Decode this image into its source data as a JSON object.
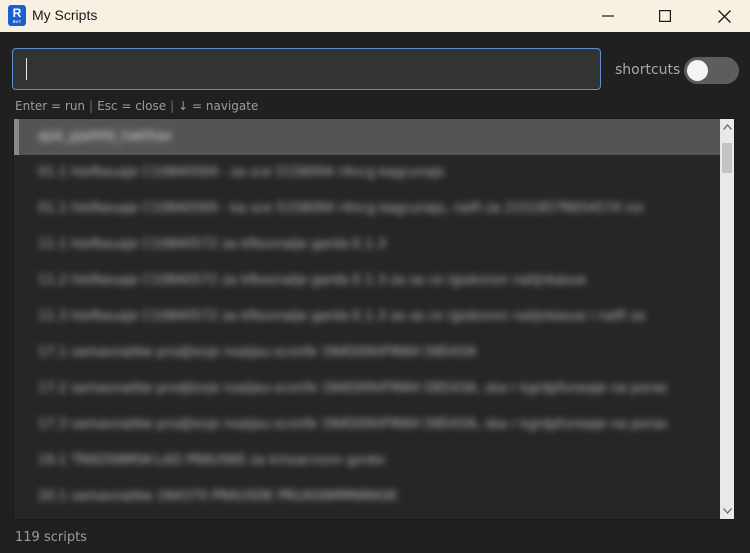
{
  "window": {
    "app_icon_letter": "R",
    "app_icon_sub": "RVT",
    "title": "My Scripts",
    "minimize_icon": "minimize-icon",
    "maximize_icon": "maximize-icon",
    "close_icon": "close-icon"
  },
  "search": {
    "value": "",
    "placeholder": ""
  },
  "shortcuts": {
    "label": "shortcuts",
    "enabled": false
  },
  "hints": {
    "run": "Enter = run",
    "close": "Esc = close",
    "navigate": "↓ = navigate",
    "separator": "|"
  },
  "scripts": {
    "items": [
      {
        "label": "ajsk_pjalhfd_haklhas"
      },
      {
        "label": "01.1 hlofkeuaje C10840569 - za sce 5158094 r4ncg kagcunajs"
      },
      {
        "label": "01.1 hlofkeuaje C10840569 - ka sce 5158094 r4ncg kagcunajs, nalfi za 2151857R654574 nsi"
      },
      {
        "label": "11.1 hlofkeuaje C10840572 za kfkovnalje garda E.1.3"
      },
      {
        "label": "11.2 hlofkeuaje C10840572 za kfkovnalje garda E.1.3 za sa ce rjpsksnsn nalijnkasue"
      },
      {
        "label": "11.3 hlofkeuaje C10840572 za kfkovnalje garda E.1.3 za sa ce rjpsksnsn nalijnkasue i nalfi za"
      },
      {
        "label": "17.1 samavnalike prsdjlsnje nsaljeu-sconfe 1N4D09VFMAH D8543A"
      },
      {
        "label": "17.2 samavnalike prsdjlsnje nsaljeu-sconfe 1N4D09VFMAH D8543A, ska r kgrdpfuneaje na poras"
      },
      {
        "label": "17.3 samavnalike prsdjlsnje nsaljeu-sconfe 1N4D09VFMAH D8543A, ska r kgrdpfuneaje na poras"
      },
      {
        "label": "19.1 TRADSNMSK-LAD PRAUSKE za kmsacnsnn gsnko"
      },
      {
        "label": "20.1 samavnalike 1N4370 PRAUSDK PRUASNMMNRASK"
      }
    ],
    "selected_index": 0
  },
  "status": {
    "count_text": "119 scripts"
  },
  "colors": {
    "accent_border": "#5e8fd6",
    "app_icon": "#1c5fd1",
    "background": "#202020",
    "titlebar": "#f8f1e2"
  }
}
